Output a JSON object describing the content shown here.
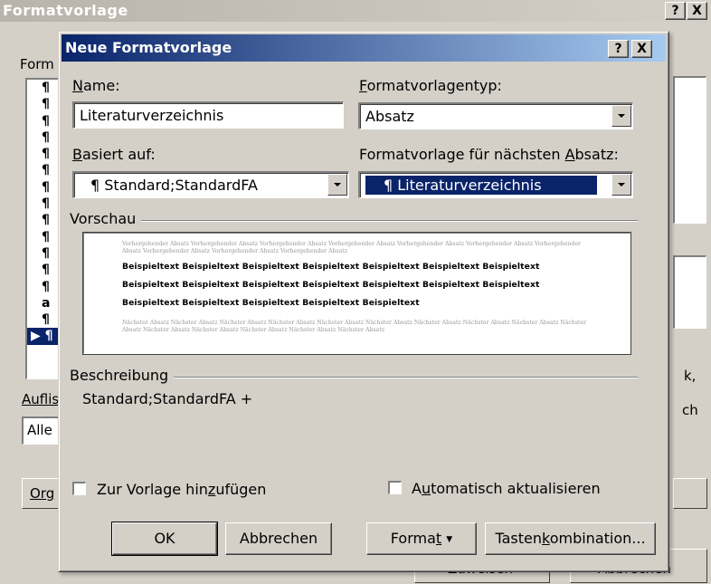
{
  "background_dialog": {
    "title": "Formatvorlage",
    "help_button": "?",
    "close_button": "X",
    "styles_label_partial": "Form",
    "style_list_markers": [
      "¶",
      "¶",
      "¶",
      "¶",
      "¶",
      "¶",
      "¶",
      "¶",
      "¶",
      "¶",
      "¶",
      "¶",
      "¶",
      "a",
      "¶",
      "▶ ¶"
    ],
    "list_label_partial": "Auflis",
    "list_value_partial": "Alle",
    "organizer_button_partial": "Org",
    "right_text_1": "k,",
    "right_text_2": "ch",
    "bottom_button_1_partial": "Zuweisen",
    "bottom_button_2_partial": "Abbrechen"
  },
  "dialog": {
    "title": "Neue Formatvorlage",
    "help_button": "?",
    "close_button": "X",
    "name": {
      "label": "Name:",
      "value": "Literaturverzeichnis"
    },
    "style_type": {
      "label": "Formatvorlagentyp:",
      "value": "Absatz"
    },
    "based_on": {
      "label": "Basiert auf:",
      "value": "¶ Standard;StandardFA"
    },
    "next_style": {
      "label": "Formatvorlage für nächsten Absatz:",
      "value": "¶ Literaturverzeichnis"
    },
    "preview": {
      "label": "Vorschau",
      "previous_paragraph": "Vorhergehender Absatz Vorhergehender Absatz Vorhergehender Absatz Vorhergehender Absatz Vorhergehender Absatz Vorhergehender Absatz Vorhergehender Absatz Vorhergehender Absatz Vorhergehender Absatz Vorhergehender Absatz",
      "sample_lines": [
        "Beispieltext  Beispieltext  Beispieltext  Beispieltext  Beispieltext  Beispieltext  Beispieltext",
        "Beispieltext  Beispieltext  Beispieltext  Beispieltext  Beispieltext  Beispieltext  Beispieltext",
        "Beispieltext Beispieltext Beispieltext Beispieltext Beispieltext"
      ],
      "next_paragraph": "Nächster Absatz Nächster Absatz Nächster Absatz Nächster Absatz Nächster Absatz Nächster Absatz Nächster Absatz Nächster Absatz Nächster Absatz Nächster Absatz Nächster Absatz Nächster Absatz Nächster Absatz Nächster Absatz Nächster Absatz"
    },
    "description": {
      "label": "Beschreibung",
      "value": "Standard;StandardFA +"
    },
    "add_to_template": "Zur Vorlage hinzufügen",
    "auto_update": "Automatisch aktualisieren",
    "buttons": {
      "ok": "OK",
      "cancel": "Abbrechen",
      "format": "Format",
      "shortcut": "Tastenkombination..."
    }
  }
}
